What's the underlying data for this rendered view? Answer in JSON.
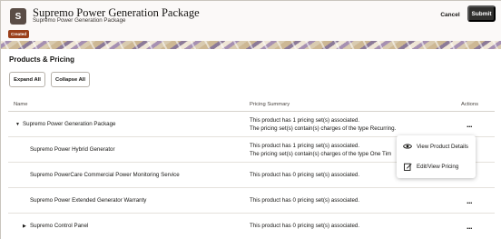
{
  "header": {
    "app_icon_letter": "S",
    "title": "Supremo Power Generation Package",
    "subtitle": "Supremo Power Generation Package",
    "status": "Created",
    "cancel_label": "Cancel",
    "submit_label": "Submit"
  },
  "section": {
    "title": "Products & Pricing",
    "expand_all": "Expand All",
    "collapse_all": "Collapse All"
  },
  "table": {
    "columns": [
      "Name",
      "Pricing Summary",
      "Actions"
    ],
    "rows": [
      {
        "name": "Supremo Power Generation Package",
        "caret": "down",
        "summary_1": "This product has 1 pricing set(s) associated.",
        "summary_2": "The pricing set(s) contain(s) charges of the type Recurring.",
        "actions": "..."
      },
      {
        "name": "Supremo Power Hybrid Generator",
        "caret": "",
        "summary_1": "This product has 1 pricing set(s) associated.",
        "summary_2": "The pricing set(s) contain(s) charges of the type One Tim",
        "actions": "..."
      },
      {
        "name": "Supremo PowerCare Commercial Power Monitoring Service",
        "caret": "",
        "summary_1": "This product has 0 pricing set(s) associated.",
        "summary_2": "",
        "actions": "..."
      },
      {
        "name": "Supremo Power Extended Generator Warranty",
        "caret": "",
        "summary_1": "This product has 0 pricing set(s) associated.",
        "summary_2": "",
        "actions": "..."
      },
      {
        "name": "Supremo Control Panel",
        "caret": "right",
        "summary_1": "This product has 0 pricing set(s) associated.",
        "summary_2": "",
        "actions": "..."
      }
    ]
  },
  "popup_menu": {
    "items": [
      {
        "label": "View Product Details",
        "icon": "eye-icon"
      },
      {
        "label": "Edit/View Pricing",
        "icon": "edit-icon"
      }
    ]
  },
  "colors": {
    "status_badge": "#9a3f1a",
    "submit_button": "#31302e",
    "header_bg": "#fbf9f8"
  }
}
